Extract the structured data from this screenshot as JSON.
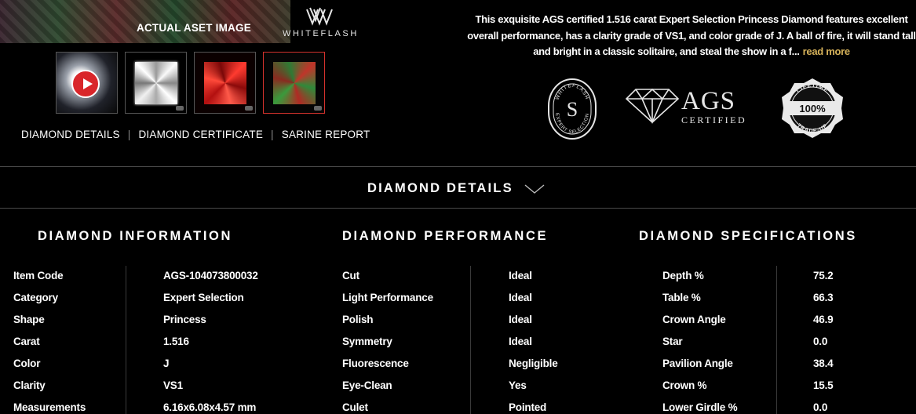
{
  "hero": {
    "label": "ACTUAL ASET IMAGE"
  },
  "brand": {
    "name": "WHITEFLASH"
  },
  "thumbnails": [
    {
      "kind": "video",
      "icon": "play-icon"
    },
    {
      "kind": "white-diamond"
    },
    {
      "kind": "idealscope"
    },
    {
      "kind": "aset",
      "active": true
    }
  ],
  "tabs": [
    "DIAMOND DETAILS",
    "DIAMOND CERTIFICATE",
    "SARINE REPORT"
  ],
  "tab_separator": "|",
  "description": {
    "text": "This exquisite AGS certified 1.516 carat Expert Selection Princess Diamond features excellent overall performance, has a clarity grade of VS1, and color grade of J. A ball of fire, it will stand tall and bright in a classic solitaire, and steal the show in a f...",
    "more": "read more"
  },
  "badges": {
    "expert_selection": {
      "top": "WHITEFLASH",
      "bottom": "EXPERT SELECTION",
      "letter": "S"
    },
    "ags": {
      "main": "AGS",
      "sub": "CERTIFIED"
    },
    "trade_up": {
      "top": "LIFETIME",
      "center": "100%",
      "bottom": "TRADE-UP"
    }
  },
  "section": {
    "title": "DIAMOND DETAILS"
  },
  "columns": {
    "information": {
      "title": "DIAMOND INFORMATION",
      "rows": [
        {
          "k": "Item Code",
          "v": "AGS-104073800032"
        },
        {
          "k": "Category",
          "v": "Expert Selection"
        },
        {
          "k": "Shape",
          "v": "Princess"
        },
        {
          "k": "Carat",
          "v": "1.516"
        },
        {
          "k": "Color",
          "v": "J"
        },
        {
          "k": "Clarity",
          "v": "VS1"
        },
        {
          "k": "Measurements",
          "v": "6.16x6.08x4.57 mm"
        }
      ]
    },
    "performance": {
      "title": "DIAMOND PERFORMANCE",
      "rows": [
        {
          "k": "Cut",
          "v": "Ideal"
        },
        {
          "k": "Light Performance",
          "v": "Ideal"
        },
        {
          "k": "Polish",
          "v": "Ideal"
        },
        {
          "k": "Symmetry",
          "v": "Ideal"
        },
        {
          "k": "Fluorescence",
          "v": "Negligible"
        },
        {
          "k": "Eye-Clean",
          "v": "Yes"
        },
        {
          "k": "Culet",
          "v": "Pointed"
        }
      ]
    },
    "specifications": {
      "title": "DIAMOND SPECIFICATIONS",
      "rows": [
        {
          "k": "Depth %",
          "v": "75.2"
        },
        {
          "k": "Table %",
          "v": "66.3"
        },
        {
          "k": "Crown Angle",
          "v": "46.9"
        },
        {
          "k": "Star",
          "v": "0.0"
        },
        {
          "k": "Pavilion Angle",
          "v": "38.4"
        },
        {
          "k": "Crown %",
          "v": "15.5"
        },
        {
          "k": "Lower Girdle %",
          "v": "0.0"
        }
      ]
    }
  },
  "colors": {
    "background": "#000000",
    "accent": "#d6b25a",
    "active_border": "#d4322c",
    "divider": "#4a4a4a"
  }
}
